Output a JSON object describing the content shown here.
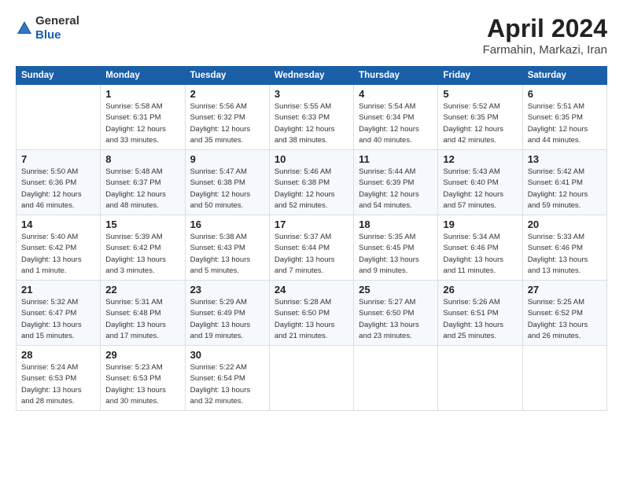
{
  "header": {
    "logo_general": "General",
    "logo_blue": "Blue",
    "title": "April 2024",
    "subtitle": "Farmahin, Markazi, Iran"
  },
  "days_of_week": [
    "Sunday",
    "Monday",
    "Tuesday",
    "Wednesday",
    "Thursday",
    "Friday",
    "Saturday"
  ],
  "weeks": [
    [
      {
        "day": "",
        "sunrise": "",
        "sunset": "",
        "daylight": ""
      },
      {
        "day": "1",
        "sunrise": "Sunrise: 5:58 AM",
        "sunset": "Sunset: 6:31 PM",
        "daylight": "Daylight: 12 hours and 33 minutes."
      },
      {
        "day": "2",
        "sunrise": "Sunrise: 5:56 AM",
        "sunset": "Sunset: 6:32 PM",
        "daylight": "Daylight: 12 hours and 35 minutes."
      },
      {
        "day": "3",
        "sunrise": "Sunrise: 5:55 AM",
        "sunset": "Sunset: 6:33 PM",
        "daylight": "Daylight: 12 hours and 38 minutes."
      },
      {
        "day": "4",
        "sunrise": "Sunrise: 5:54 AM",
        "sunset": "Sunset: 6:34 PM",
        "daylight": "Daylight: 12 hours and 40 minutes."
      },
      {
        "day": "5",
        "sunrise": "Sunrise: 5:52 AM",
        "sunset": "Sunset: 6:35 PM",
        "daylight": "Daylight: 12 hours and 42 minutes."
      },
      {
        "day": "6",
        "sunrise": "Sunrise: 5:51 AM",
        "sunset": "Sunset: 6:35 PM",
        "daylight": "Daylight: 12 hours and 44 minutes."
      }
    ],
    [
      {
        "day": "7",
        "sunrise": "Sunrise: 5:50 AM",
        "sunset": "Sunset: 6:36 PM",
        "daylight": "Daylight: 12 hours and 46 minutes."
      },
      {
        "day": "8",
        "sunrise": "Sunrise: 5:48 AM",
        "sunset": "Sunset: 6:37 PM",
        "daylight": "Daylight: 12 hours and 48 minutes."
      },
      {
        "day": "9",
        "sunrise": "Sunrise: 5:47 AM",
        "sunset": "Sunset: 6:38 PM",
        "daylight": "Daylight: 12 hours and 50 minutes."
      },
      {
        "day": "10",
        "sunrise": "Sunrise: 5:46 AM",
        "sunset": "Sunset: 6:38 PM",
        "daylight": "Daylight: 12 hours and 52 minutes."
      },
      {
        "day": "11",
        "sunrise": "Sunrise: 5:44 AM",
        "sunset": "Sunset: 6:39 PM",
        "daylight": "Daylight: 12 hours and 54 minutes."
      },
      {
        "day": "12",
        "sunrise": "Sunrise: 5:43 AM",
        "sunset": "Sunset: 6:40 PM",
        "daylight": "Daylight: 12 hours and 57 minutes."
      },
      {
        "day": "13",
        "sunrise": "Sunrise: 5:42 AM",
        "sunset": "Sunset: 6:41 PM",
        "daylight": "Daylight: 12 hours and 59 minutes."
      }
    ],
    [
      {
        "day": "14",
        "sunrise": "Sunrise: 5:40 AM",
        "sunset": "Sunset: 6:42 PM",
        "daylight": "Daylight: 13 hours and 1 minute."
      },
      {
        "day": "15",
        "sunrise": "Sunrise: 5:39 AM",
        "sunset": "Sunset: 6:42 PM",
        "daylight": "Daylight: 13 hours and 3 minutes."
      },
      {
        "day": "16",
        "sunrise": "Sunrise: 5:38 AM",
        "sunset": "Sunset: 6:43 PM",
        "daylight": "Daylight: 13 hours and 5 minutes."
      },
      {
        "day": "17",
        "sunrise": "Sunrise: 5:37 AM",
        "sunset": "Sunset: 6:44 PM",
        "daylight": "Daylight: 13 hours and 7 minutes."
      },
      {
        "day": "18",
        "sunrise": "Sunrise: 5:35 AM",
        "sunset": "Sunset: 6:45 PM",
        "daylight": "Daylight: 13 hours and 9 minutes."
      },
      {
        "day": "19",
        "sunrise": "Sunrise: 5:34 AM",
        "sunset": "Sunset: 6:46 PM",
        "daylight": "Daylight: 13 hours and 11 minutes."
      },
      {
        "day": "20",
        "sunrise": "Sunrise: 5:33 AM",
        "sunset": "Sunset: 6:46 PM",
        "daylight": "Daylight: 13 hours and 13 minutes."
      }
    ],
    [
      {
        "day": "21",
        "sunrise": "Sunrise: 5:32 AM",
        "sunset": "Sunset: 6:47 PM",
        "daylight": "Daylight: 13 hours and 15 minutes."
      },
      {
        "day": "22",
        "sunrise": "Sunrise: 5:31 AM",
        "sunset": "Sunset: 6:48 PM",
        "daylight": "Daylight: 13 hours and 17 minutes."
      },
      {
        "day": "23",
        "sunrise": "Sunrise: 5:29 AM",
        "sunset": "Sunset: 6:49 PM",
        "daylight": "Daylight: 13 hours and 19 minutes."
      },
      {
        "day": "24",
        "sunrise": "Sunrise: 5:28 AM",
        "sunset": "Sunset: 6:50 PM",
        "daylight": "Daylight: 13 hours and 21 minutes."
      },
      {
        "day": "25",
        "sunrise": "Sunrise: 5:27 AM",
        "sunset": "Sunset: 6:50 PM",
        "daylight": "Daylight: 13 hours and 23 minutes."
      },
      {
        "day": "26",
        "sunrise": "Sunrise: 5:26 AM",
        "sunset": "Sunset: 6:51 PM",
        "daylight": "Daylight: 13 hours and 25 minutes."
      },
      {
        "day": "27",
        "sunrise": "Sunrise: 5:25 AM",
        "sunset": "Sunset: 6:52 PM",
        "daylight": "Daylight: 13 hours and 26 minutes."
      }
    ],
    [
      {
        "day": "28",
        "sunrise": "Sunrise: 5:24 AM",
        "sunset": "Sunset: 6:53 PM",
        "daylight": "Daylight: 13 hours and 28 minutes."
      },
      {
        "day": "29",
        "sunrise": "Sunrise: 5:23 AM",
        "sunset": "Sunset: 6:53 PM",
        "daylight": "Daylight: 13 hours and 30 minutes."
      },
      {
        "day": "30",
        "sunrise": "Sunrise: 5:22 AM",
        "sunset": "Sunset: 6:54 PM",
        "daylight": "Daylight: 13 hours and 32 minutes."
      },
      {
        "day": "",
        "sunrise": "",
        "sunset": "",
        "daylight": ""
      },
      {
        "day": "",
        "sunrise": "",
        "sunset": "",
        "daylight": ""
      },
      {
        "day": "",
        "sunrise": "",
        "sunset": "",
        "daylight": ""
      },
      {
        "day": "",
        "sunrise": "",
        "sunset": "",
        "daylight": ""
      }
    ]
  ]
}
